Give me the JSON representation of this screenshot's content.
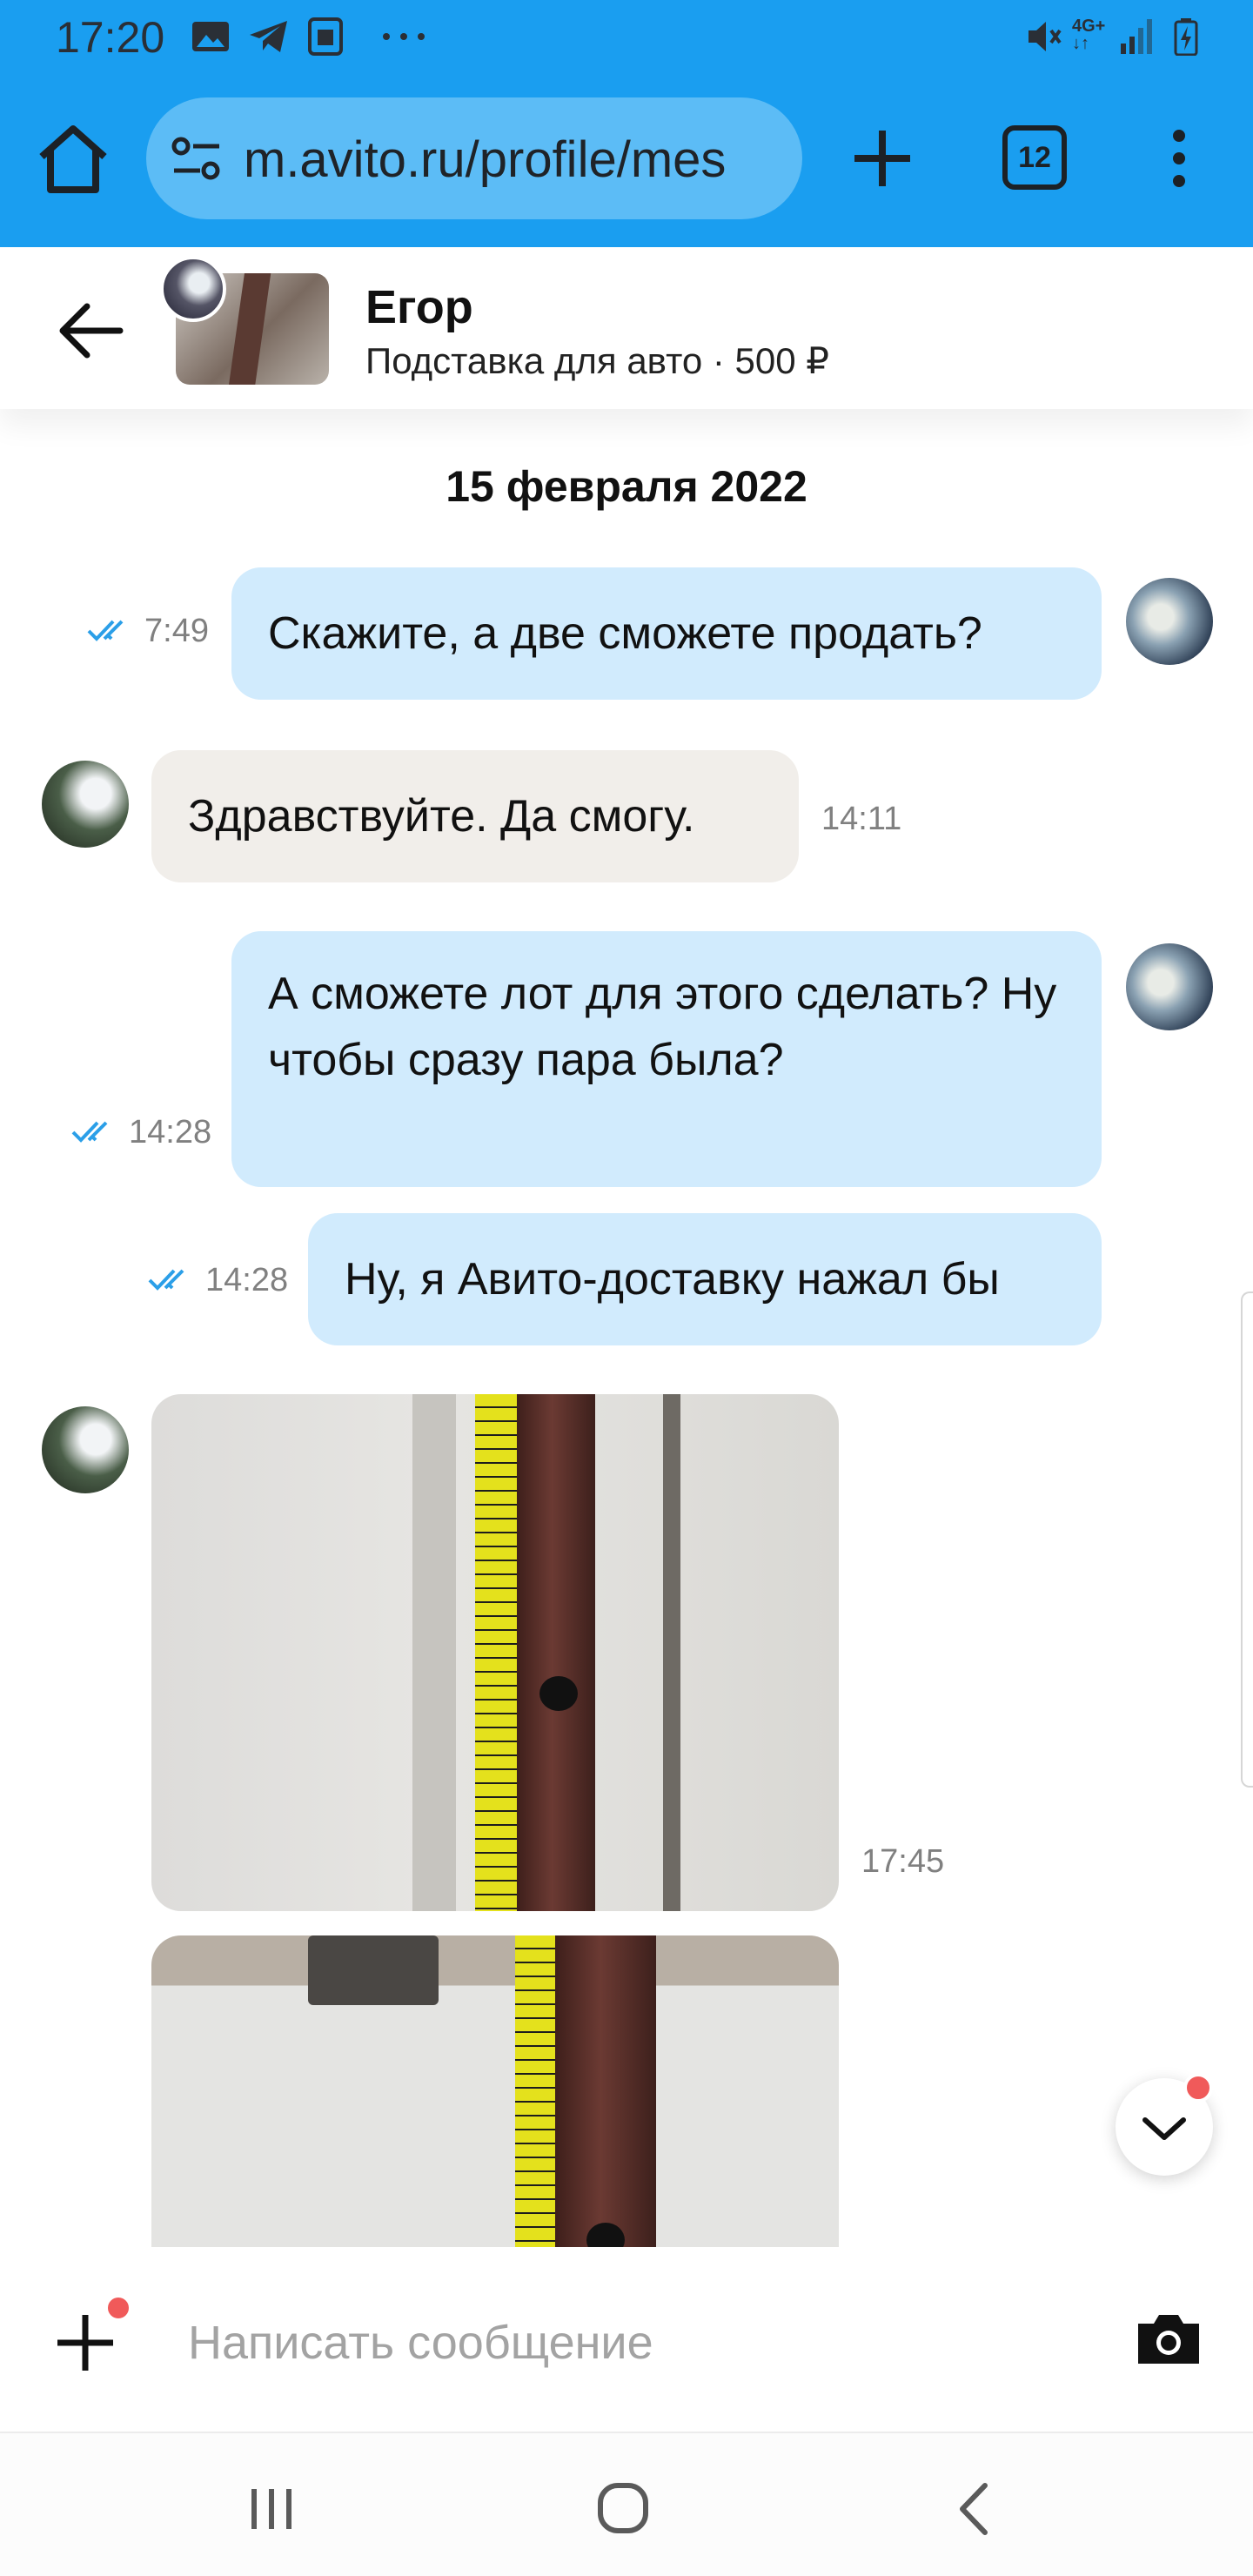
{
  "status_bar": {
    "time": "17:20",
    "left_icons": [
      "image-icon",
      "telegram-icon",
      "sim-icon",
      "more-icon"
    ],
    "right_icons": [
      "mute-icon",
      "4g-icon",
      "signal-icon",
      "battery-icon"
    ],
    "network": "4G+"
  },
  "browser": {
    "url": "m.avito.ru/profile/mes",
    "tab_count": "12",
    "accent_color": "#1a9ef0"
  },
  "chat": {
    "peer_name": "Егор",
    "item_title": "Подставка для авто · 500 ₽",
    "date_separator": "15 февраля 2022",
    "messages": [
      {
        "side": "out",
        "text": "Скажите, а две сможете продать?",
        "time": "7:49",
        "read": true
      },
      {
        "side": "in",
        "text": "Здравствуйте. Да смогу.",
        "time": "14:11"
      },
      {
        "side": "out",
        "text": "А сможете лот для этого сделать? Ну чтобы сразу пара была?",
        "time": "14:28",
        "read": true
      },
      {
        "side": "out",
        "text": "Ну, я Авито-доставку нажал бы",
        "time": "14:28",
        "read": true
      },
      {
        "side": "in",
        "type": "photo",
        "time": "17:45"
      },
      {
        "side": "in",
        "type": "photo"
      }
    ]
  },
  "composer": {
    "placeholder": "Написать сообщение"
  }
}
